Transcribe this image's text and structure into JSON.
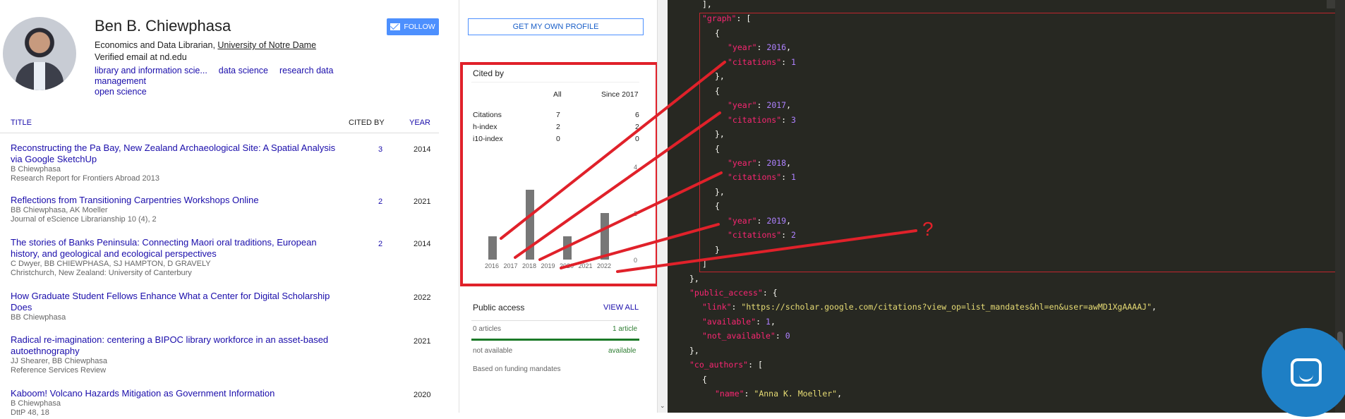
{
  "profile": {
    "name": "Ben B. Chiewphasa",
    "affiliation_prefix": "Economics and Data Librarian, ",
    "affiliation_link": "University of Notre Dame",
    "email": "Verified email at nd.edu",
    "interests": [
      "library and information scie...",
      "data science",
      "research data management",
      "open science"
    ],
    "follow_label": "FOLLOW",
    "get_profile_label": "GET MY OWN PROFILE"
  },
  "table": {
    "title_header": "TITLE",
    "cited_header": "CITED BY",
    "year_header": "YEAR",
    "rows": [
      {
        "title": "Reconstructing the Pa Bay, New Zealand Archaeological Site: A Spatial Analysis via Google SketchUp",
        "authors": "B Chiewphasa",
        "venue": "Research Report for Frontiers Abroad 2013",
        "cited": "3",
        "year": "2014"
      },
      {
        "title": "Reflections from Transitioning Carpentries Workshops Online",
        "authors": "BB Chiewphasa, AK Moeller",
        "venue": "Journal of eScience Librarianship 10 (4), 2",
        "cited": "2",
        "year": "2021"
      },
      {
        "title": "The stories of Banks Peninsula: Connecting Maori oral traditions, European history, and geological and ecological perspectives",
        "authors": "C Dwyer, BB CHIEWPHASA, SJ HAMPTON, D GRAVELY",
        "venue": "Christchurch, New Zealand: University of Canterbury",
        "cited": "2",
        "year": "2014"
      },
      {
        "title": "How Graduate Student Fellows Enhance What a Center for Digital Scholarship Does",
        "authors": "BB Chiewphasa",
        "venue": "",
        "cited": "",
        "year": "2022"
      },
      {
        "title": "Radical re-imagination: centering a BIPOC library workforce in an asset-based autoethnography",
        "authors": "JJ Shearer, BB Chiewphasa",
        "venue": "Reference Services Review",
        "cited": "",
        "year": "2021"
      },
      {
        "title": "Kaboom! Volcano Hazards Mitigation as Government Information",
        "authors": "B Chiewphasa",
        "venue": "DttP 48, 18",
        "cited": "",
        "year": "2020"
      }
    ]
  },
  "cited_by": {
    "title": "Cited by",
    "col_all": "All",
    "col_since": "Since 2017",
    "rows": [
      {
        "label": "Citations",
        "all": "7",
        "since": "6"
      },
      {
        "label": "h-index",
        "all": "2",
        "since": "2"
      },
      {
        "label": "i10-index",
        "all": "0",
        "since": "0"
      }
    ],
    "axis_ticks": [
      "4",
      "2",
      "0"
    ]
  },
  "chart_data": {
    "type": "bar",
    "categories": [
      "2016",
      "2017",
      "2018",
      "2019",
      "2020",
      "2021",
      "2022"
    ],
    "values": [
      1,
      0,
      3,
      0,
      1,
      0,
      2
    ],
    "ylim": [
      0,
      4
    ],
    "title": "",
    "xlabel": "",
    "ylabel": ""
  },
  "public_access": {
    "title": "Public access",
    "view_all": "VIEW ALL",
    "not_available_count": "0 articles",
    "available_count": "1 article",
    "not_available_label": "not available",
    "available_label": "available",
    "note": "Based on funding mandates"
  },
  "code": {
    "lines": [
      {
        "indent": 0,
        "parts": [
          [
            "p",
            "],"
          ]
        ]
      },
      {
        "indent": 0,
        "parts": [
          [
            "k",
            "\"graph\""
          ],
          [
            "p",
            ": ["
          ]
        ]
      },
      {
        "indent": 1,
        "parts": [
          [
            "p",
            "{"
          ]
        ]
      },
      {
        "indent": 2,
        "parts": [
          [
            "k",
            "\"year\""
          ],
          [
            "p",
            ": "
          ],
          [
            "n",
            "2016"
          ],
          [
            "p",
            ","
          ]
        ]
      },
      {
        "indent": 2,
        "parts": [
          [
            "k",
            "\"citations\""
          ],
          [
            "p",
            ": "
          ],
          [
            "n",
            "1"
          ]
        ]
      },
      {
        "indent": 1,
        "parts": [
          [
            "p",
            "},"
          ]
        ]
      },
      {
        "indent": 1,
        "parts": [
          [
            "p",
            "{"
          ]
        ]
      },
      {
        "indent": 2,
        "parts": [
          [
            "k",
            "\"year\""
          ],
          [
            "p",
            ": "
          ],
          [
            "n",
            "2017"
          ],
          [
            "p",
            ","
          ]
        ]
      },
      {
        "indent": 2,
        "parts": [
          [
            "k",
            "\"citations\""
          ],
          [
            "p",
            ": "
          ],
          [
            "n",
            "3"
          ]
        ]
      },
      {
        "indent": 1,
        "parts": [
          [
            "p",
            "},"
          ]
        ]
      },
      {
        "indent": 1,
        "parts": [
          [
            "p",
            "{"
          ]
        ]
      },
      {
        "indent": 2,
        "parts": [
          [
            "k",
            "\"year\""
          ],
          [
            "p",
            ": "
          ],
          [
            "n",
            "2018"
          ],
          [
            "p",
            ","
          ]
        ]
      },
      {
        "indent": 2,
        "parts": [
          [
            "k",
            "\"citations\""
          ],
          [
            "p",
            ": "
          ],
          [
            "n",
            "1"
          ]
        ]
      },
      {
        "indent": 1,
        "parts": [
          [
            "p",
            "},"
          ]
        ]
      },
      {
        "indent": 1,
        "parts": [
          [
            "p",
            "{"
          ]
        ]
      },
      {
        "indent": 2,
        "parts": [
          [
            "k",
            "\"year\""
          ],
          [
            "p",
            ": "
          ],
          [
            "n",
            "2019"
          ],
          [
            "p",
            ","
          ]
        ]
      },
      {
        "indent": 2,
        "parts": [
          [
            "k",
            "\"citations\""
          ],
          [
            "p",
            ": "
          ],
          [
            "n",
            "2"
          ]
        ]
      },
      {
        "indent": 1,
        "parts": [
          [
            "p",
            "}"
          ]
        ]
      },
      {
        "indent": 0,
        "parts": [
          [
            "p",
            "]"
          ]
        ]
      },
      {
        "indent": -1,
        "parts": [
          [
            "p",
            "},"
          ]
        ]
      },
      {
        "indent": -1,
        "parts": [
          [
            "k",
            "\"public_access\""
          ],
          [
            "p",
            ": {"
          ]
        ]
      },
      {
        "indent": 0,
        "parts": [
          [
            "k",
            "\"link\""
          ],
          [
            "p",
            ": "
          ],
          [
            "s",
            "\"https://scholar.google.com/citations?view_op=list_mandates&hl=en&user=awMD1XgAAAAJ\""
          ],
          [
            "p",
            ","
          ]
        ]
      },
      {
        "indent": 0,
        "parts": [
          [
            "k",
            "\"available\""
          ],
          [
            "p",
            ": "
          ],
          [
            "n",
            "1"
          ],
          [
            "p",
            ","
          ]
        ]
      },
      {
        "indent": 0,
        "parts": [
          [
            "k",
            "\"not_available\""
          ],
          [
            "p",
            ": "
          ],
          [
            "n",
            "0"
          ]
        ]
      },
      {
        "indent": -1,
        "parts": [
          [
            "p",
            "},"
          ]
        ]
      },
      {
        "indent": -1,
        "parts": [
          [
            "k",
            "\"co_authors\""
          ],
          [
            "p",
            ": ["
          ]
        ]
      },
      {
        "indent": 0,
        "parts": [
          [
            "p",
            "{"
          ]
        ]
      },
      {
        "indent": 1,
        "parts": [
          [
            "k",
            "\"name\""
          ],
          [
            "p",
            ": "
          ],
          [
            "s",
            "\"Anna K. Moeller\""
          ],
          [
            "p",
            ","
          ]
        ]
      }
    ]
  },
  "annotation": {
    "question_mark": "?",
    "color": "#e0212a"
  },
  "colors": {
    "accent": "#4d90fe",
    "link": "#1a0dab",
    "code_bg": "#272822",
    "annotation": "#e0212a",
    "chat_bubble": "#1e7fc5"
  }
}
